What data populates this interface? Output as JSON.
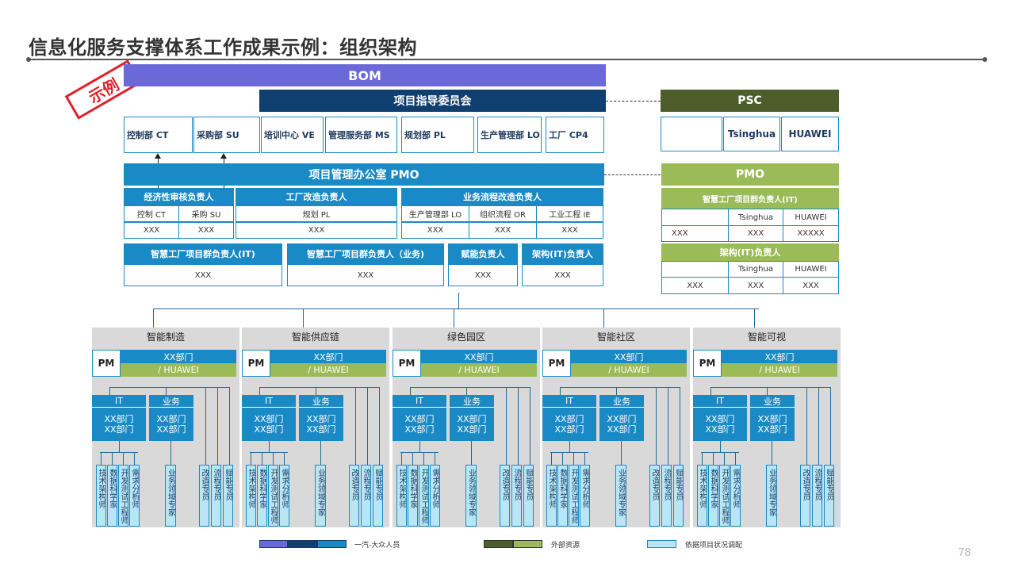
{
  "title": "信息化服务支撑体系工作成果示例：组织架构",
  "stamp": "示例",
  "bom": "BOM",
  "steering": "项目指导委员会",
  "psc": "PSC",
  "depts": [
    "控制部 CT",
    "采购部 SU",
    "培训中心 VE",
    "管理服务部 MS",
    "规划部 PL",
    "生产管理部 LO",
    "工厂  CP4"
  ],
  "psc_cells": [
    "",
    "Tsinghua",
    "HUAWEI"
  ],
  "pmo": "项目管理办公室 PMO",
  "pmo_right": "PMO",
  "groups": [
    {
      "head": "经济性审核负责人",
      "cols": [
        "控制 CT",
        "采购 SU"
      ],
      "vals": [
        "XXX",
        "XXX"
      ]
    },
    {
      "head": "工厂改造负责人",
      "cols": [
        "规划 PL"
      ],
      "vals": [
        "XXX"
      ]
    },
    {
      "head": "业务流程改造负责人",
      "cols": [
        "生产管理部 LO",
        "组织流程 OR",
        "工业工程 IE"
      ],
      "vals": [
        "XXX",
        "XXX",
        "XXX"
      ]
    }
  ],
  "leads": [
    {
      "head": "智慧工厂项目群负责人(IT)",
      "val": "XXX"
    },
    {
      "head": "智慧工厂项目群负责人（业务)",
      "val": "XXX"
    },
    {
      "head": "赋能负责人",
      "val": "XXX"
    },
    {
      "head": "架构(IT)负责人",
      "val": "XXX"
    }
  ],
  "right1": {
    "head": "智慧工厂项目群负责人(IT)",
    "cols": [
      "",
      "Tsinghua",
      "HUAWEI"
    ],
    "vals": [
      "XXX",
      "XXX",
      "XXXXX"
    ]
  },
  "right2": {
    "head": "架构(IT)负责人",
    "cols": [
      "",
      "Tsinghua",
      "HUAWEI"
    ],
    "vals": [
      "XXX",
      "XXX",
      "XXX"
    ]
  },
  "columns": [
    "智能制造",
    "智能供应链",
    "绿色园区",
    "智能社区",
    "智能可视"
  ],
  "pm": "PM",
  "xxdept": "XX部门",
  "huawei": "/ HUAWEI",
  "it": "IT",
  "biz": "业务",
  "xxdept2": "XX部门\nXX部门",
  "roles": [
    "技术架构师",
    "数据科学家",
    "开发测试工程师",
    "需求分析师",
    "业务领域专家",
    "改造专员",
    "流程专员",
    "赋能专员"
  ],
  "legend": [
    "一汽-大众人员",
    "外部资源",
    "依据项目状况调配"
  ],
  "page": "78",
  "colors": {
    "purple": "#6b68d9",
    "dblue": "#0e3f6e",
    "blue": "#1a8ac6",
    "olive": "#4d5d2c",
    "lgreen": "#9bbb59",
    "lightblue": "#b8e6f5"
  }
}
